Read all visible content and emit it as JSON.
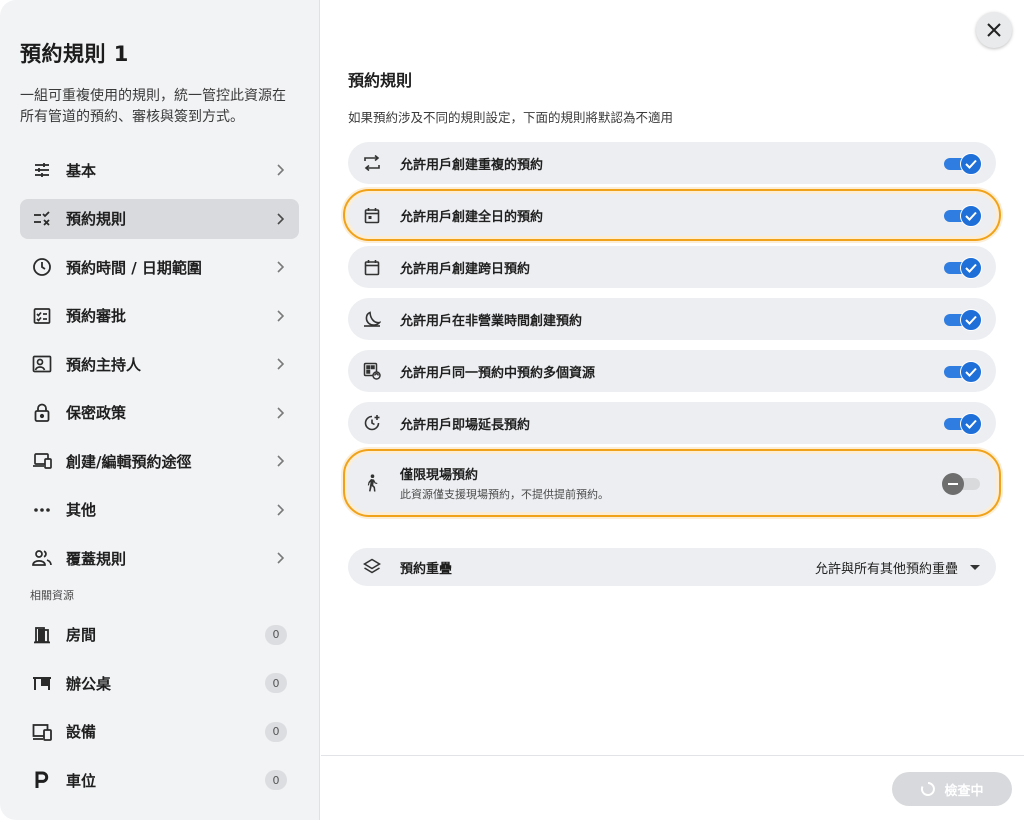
{
  "sidebar": {
    "title": "預約規則 1",
    "description": "一組可重複使用的規則，統一管控此資源在所有管道的預約、審核與簽到方式。",
    "nav": [
      {
        "label": "基本",
        "icon": "tune-icon"
      },
      {
        "label": "預約規則",
        "icon": "checklist-icon",
        "active": true
      },
      {
        "label": "預約時間 / 日期範圍",
        "icon": "clock-icon"
      },
      {
        "label": "預約審批",
        "icon": "approval-icon"
      },
      {
        "label": "預約主持人",
        "icon": "host-icon"
      },
      {
        "label": "保密政策",
        "icon": "lock-icon"
      },
      {
        "label": "創建/編輯預約途徑",
        "icon": "devices-icon"
      },
      {
        "label": "其他",
        "icon": "more-icon"
      },
      {
        "label": "覆蓋規則",
        "icon": "people-icon"
      }
    ],
    "resources_label": "相關資源",
    "resources": [
      {
        "label": "房間",
        "count": "0",
        "icon": "door-icon"
      },
      {
        "label": "辦公桌",
        "count": "0",
        "icon": "desk-icon"
      },
      {
        "label": "設備",
        "count": "0",
        "icon": "equipment-icon"
      },
      {
        "label": "車位",
        "count": "0",
        "icon": "parking-icon"
      }
    ]
  },
  "main": {
    "title": "預約規則",
    "subtitle": "如果預約涉及不同的規則設定，下面的規則將默認為不適用",
    "rules": [
      {
        "label": "允許用戶創建重複的預約",
        "icon": "repeat-icon",
        "enabled": true
      },
      {
        "label": "允許用戶創建全日的預約",
        "icon": "calendar-day-icon",
        "enabled": true
      },
      {
        "label": "允許用戶創建跨日預約",
        "icon": "calendar-icon",
        "enabled": true
      },
      {
        "label": "允許用戶在非營業時間創建預約",
        "icon": "moon-icon",
        "enabled": true
      },
      {
        "label": "允許用戶同一預約中預約多個資源",
        "icon": "multi-resource-icon",
        "enabled": true
      },
      {
        "label": "允許用戶即場延長預約",
        "icon": "clock-extend-icon",
        "enabled": true
      },
      {
        "label": "僅限現場預約",
        "hint": "此資源僅支援現場預約，不提供提前預約。",
        "icon": "walk-icon",
        "enabled": false
      }
    ],
    "overlap": {
      "label": "預約重疊",
      "value": "允許與所有其他預約重疊",
      "icon": "layers-icon"
    },
    "check_button": "檢查中"
  },
  "colors": {
    "accent": "#1f6fd9",
    "highlight": "#f0a21a"
  }
}
